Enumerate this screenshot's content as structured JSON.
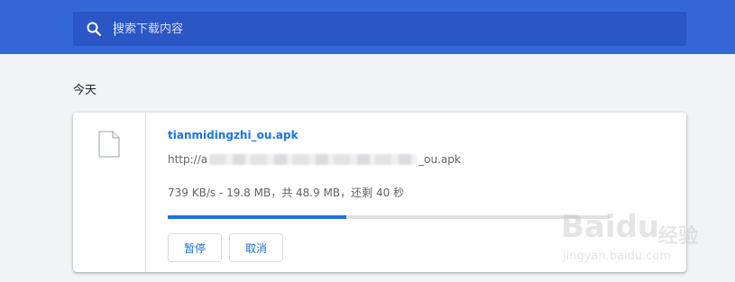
{
  "header": {
    "search_placeholder": "搜索下载内容",
    "search_value": ""
  },
  "section": {
    "date_label": "今天"
  },
  "download": {
    "file_name": "tianmidingzhi_ou.apk",
    "url_prefix": "http://a",
    "url_suffix": "_ou.apk",
    "progress_text": "739 KB/s - 19.8 MB，共 48.9 MB，还剩 40 秒",
    "progress_fraction": 0.405,
    "pause_label": "暂停",
    "cancel_label": "取消"
  },
  "watermark": {
    "logo_text": "Baidu",
    "cn_text": "经验",
    "url_text": "jingyan.baidu.com"
  },
  "colors": {
    "header_bg": "#3367d6",
    "search_bg": "#2a56c6",
    "accent": "#1a73e8",
    "page_bg": "#f1f3f4"
  },
  "icons": {
    "search": "search-icon",
    "file": "file-icon"
  }
}
